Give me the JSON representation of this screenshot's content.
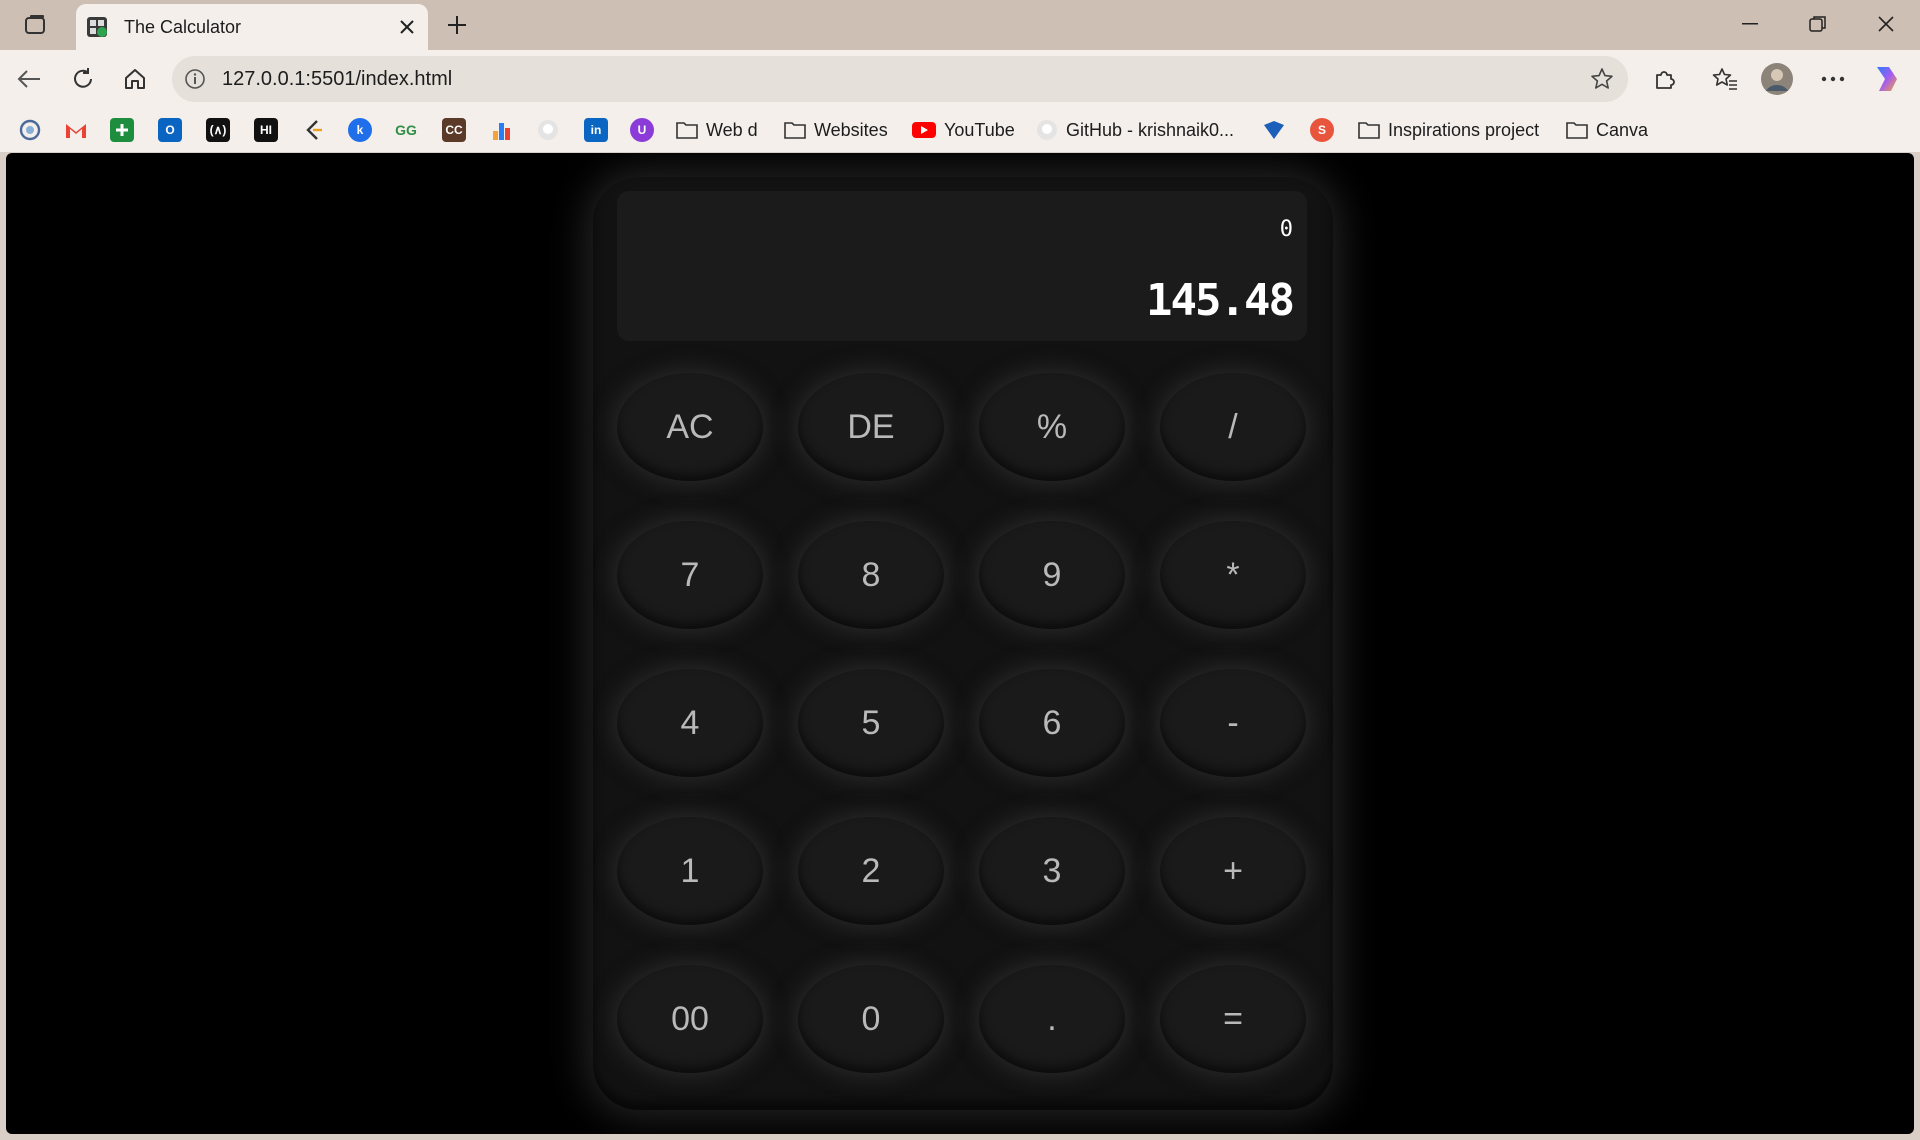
{
  "browser": {
    "tab": {
      "title": "The Calculator"
    },
    "address": {
      "url": "127.0.0.1:5501/index.html"
    },
    "bookmarks": [
      {
        "label": "Web d"
      },
      {
        "label": "Websites"
      },
      {
        "label": "YouTube"
      },
      {
        "label": "GitHub - krishnaik0..."
      },
      {
        "label": "Inspirations project"
      },
      {
        "label": "Canva"
      }
    ],
    "bookmark_icons": [
      "edge-icon",
      "gmail-icon",
      "sheets-icon",
      "outlook-icon",
      "devto-icon",
      "hashnode-icon",
      "leetcode-icon",
      "blue-k-icon",
      "geeksforgeeks-icon",
      "codechef-icon",
      "chart-icon",
      "github-icon",
      "linkedin-icon",
      "purple-u-icon"
    ]
  },
  "calculator": {
    "expression": "0",
    "result": "145.48",
    "keys": [
      "AC",
      "DE",
      "%",
      "/",
      "7",
      "8",
      "9",
      "*",
      "4",
      "5",
      "6",
      "-",
      "1",
      "2",
      "3",
      "+",
      "00",
      "0",
      ".",
      "="
    ]
  },
  "colors": {
    "accent": "#4c8bf5",
    "page_bg": "#000000",
    "calc_body": "#121212",
    "key_text": "#b9b9b9"
  }
}
